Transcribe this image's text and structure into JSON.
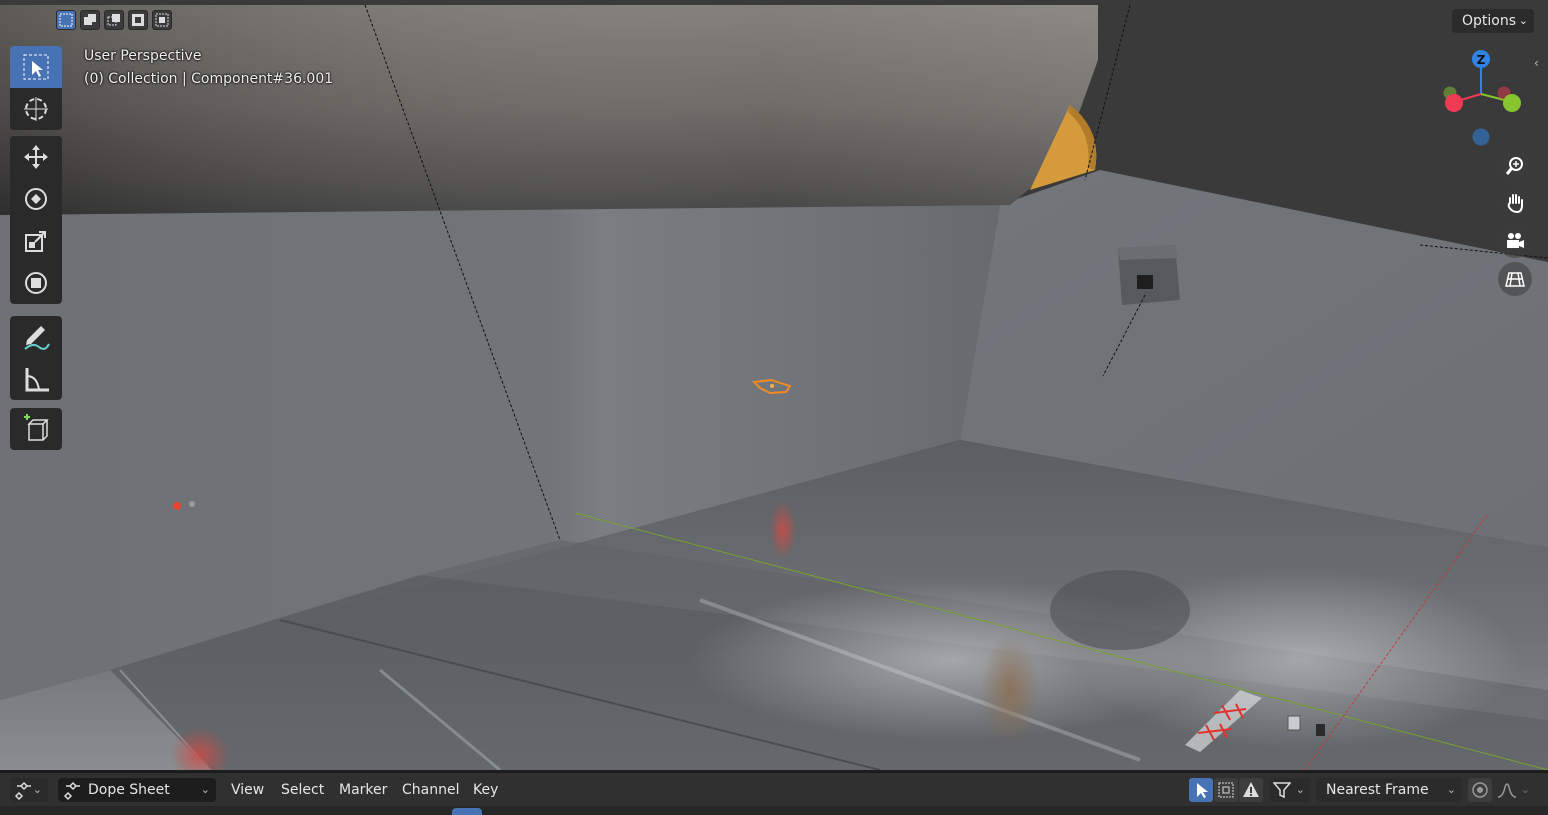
{
  "viewport": {
    "view_name": "User Perspective",
    "object_info": "(0) Collection | Component#36.001",
    "options_label": "Options",
    "selection_modes": [
      "select-new-icon",
      "select-extend-icon",
      "select-subtract-icon",
      "select-invert-icon",
      "select-intersect-icon"
    ],
    "tools": [
      "select-box-icon",
      "cursor-icon",
      "move-icon",
      "rotate-icon",
      "scale-icon",
      "transform-icon",
      "annotate-icon",
      "measure-icon",
      "add-cube-icon"
    ],
    "nav_buttons": [
      "zoom-icon",
      "hand-pan-icon",
      "camera-icon",
      "grid-ortho-icon"
    ],
    "gizmo": {
      "z_label": "Z",
      "x_color": "#ee3a52",
      "y_color": "#86c430",
      "z_color": "#2f84e3"
    }
  },
  "dopesheet": {
    "editor_type": "Dope Sheet",
    "menus": [
      "View",
      "Select",
      "Marker",
      "Channel",
      "Key"
    ],
    "snap_mode": "Nearest Frame"
  },
  "colors": {
    "accent": "#4772b3",
    "header_bg": "#303030",
    "panel_bg": "#2a2a2a"
  }
}
